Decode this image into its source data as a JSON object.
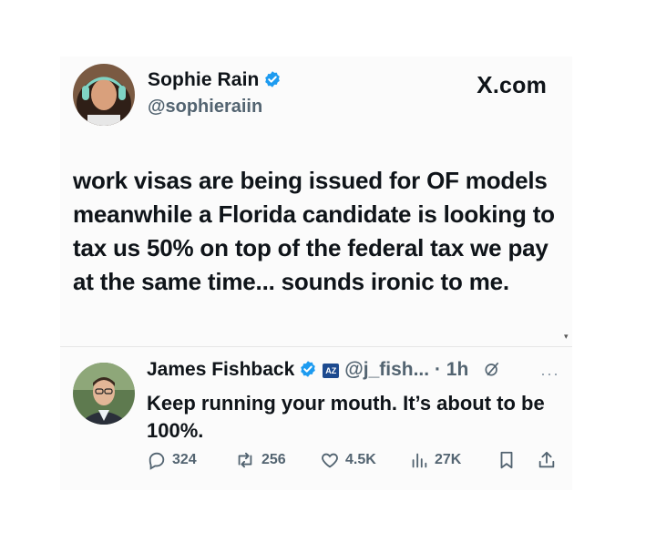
{
  "tweet": {
    "author_name": "Sophie Rain",
    "author_handle": "@sophieraiin",
    "source_label": ".com",
    "source_glyph": "X",
    "text": "work visas are being issued for OF models meanwhile a Florida candidate is looking to tax us 50% on top of the federal tax we pay at the same time... sounds ironic to me."
  },
  "reply": {
    "author_name": "James Fishback",
    "org_badge": "AZ",
    "author_handle": "@j_fish...",
    "separator": "·",
    "time": "1h",
    "more_label": "···",
    "text": "Keep running your mouth. It’s about to be 100%.",
    "stats": {
      "replies": "324",
      "reposts": "256",
      "likes": "4.5K",
      "views": "27K"
    }
  },
  "colors": {
    "verified_blue": "#1d9bf0",
    "text_primary": "#0f1419",
    "text_secondary": "#536471"
  },
  "icons": [
    "verified-badge-icon",
    "reply-icon",
    "repost-icon",
    "like-icon",
    "views-icon",
    "bookmark-icon",
    "share-icon",
    "grok-icon"
  ]
}
